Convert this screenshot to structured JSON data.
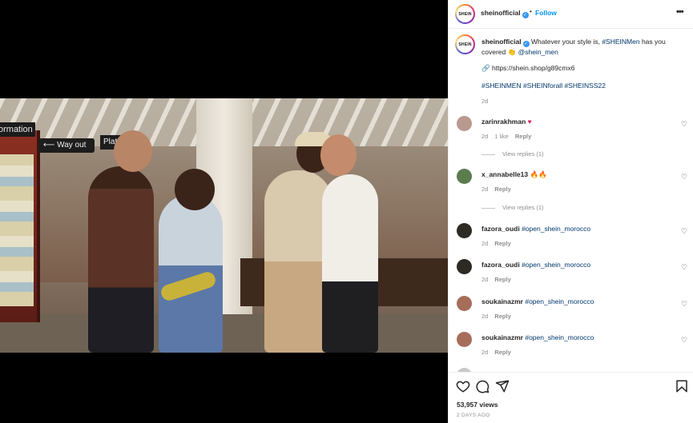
{
  "video": {
    "sign_info": "ormation",
    "sign_way_out": "Way out",
    "sign_platform": "Platf"
  },
  "post": {
    "username": "sheinofficial",
    "avatar_text": "SHEIN",
    "follow_label": "Follow",
    "caption_text": "Whatever your style is,",
    "caption_tag": "#SHEINMen",
    "caption_text2": "has you covered",
    "caption_emoji": "👏",
    "caption_mention": "@shein_men",
    "link_emoji": "🔗",
    "link": "https://shein.shop/g89cmx6",
    "hashtags": "#SHEINMEN #SHEINforall #SHEINSS22",
    "age": "2d"
  },
  "comments": [
    {
      "username": "zarinrakhman",
      "text": "",
      "emoji": "♥",
      "age": "2d",
      "likes": "1 like",
      "reply_label": "Reply",
      "view_replies": "View replies (1)",
      "avatar_color": "#b89a8f"
    },
    {
      "username": "x_annabelle13",
      "text": "",
      "emoji": "🔥🔥",
      "age": "2d",
      "likes": "",
      "reply_label": "Reply",
      "view_replies": "View replies (1)",
      "avatar_color": "#5b7d4e"
    },
    {
      "username": "fazora_oudi",
      "text": "#open_shein_morocco",
      "emoji": "",
      "age": "2d",
      "likes": "",
      "reply_label": "Reply",
      "view_replies": "",
      "avatar_color": "#2d2a24"
    },
    {
      "username": "fazora_oudi",
      "text": "#open_shein_morocco",
      "emoji": "",
      "age": "2d",
      "likes": "",
      "reply_label": "Reply",
      "view_replies": "",
      "avatar_color": "#2d2a24"
    },
    {
      "username": "soukainazmr",
      "text": "#open_shein_morocco",
      "emoji": "",
      "age": "2d",
      "likes": "",
      "reply_label": "Reply",
      "view_replies": "",
      "avatar_color": "#a66e5a"
    },
    {
      "username": "soukainazmr",
      "text": "#open_shein_morocco",
      "emoji": "",
      "age": "2d",
      "likes": "",
      "reply_label": "Reply",
      "view_replies": "",
      "avatar_color": "#a66e5a"
    }
  ],
  "footer": {
    "views": "53,957 views",
    "posted": "2 DAYS AGO"
  },
  "icons": {
    "like": "heart-icon",
    "comment": "comment-icon",
    "share": "share-icon",
    "save": "bookmark-icon",
    "more": "more-options-icon"
  },
  "colors": {
    "link_blue": "#0095f6",
    "hashtag_blue": "#00376b",
    "muted": "#8e8e8e",
    "verified": "#3897f0"
  }
}
